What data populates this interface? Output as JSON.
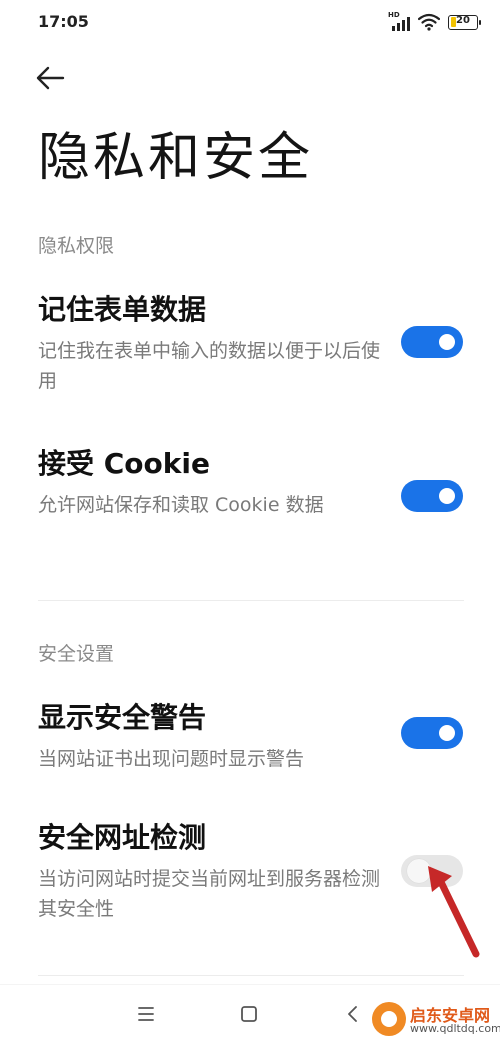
{
  "status_bar": {
    "time": "17:05",
    "network_label": "HD",
    "battery_level": "20",
    "battery_fraction": 0.2,
    "battery_color": "#f2c200"
  },
  "header": {
    "back_icon": "arrow-left-icon",
    "title": "隐私和安全"
  },
  "sections": [
    {
      "header": "隐私权限",
      "items": [
        {
          "title": "记住表单数据",
          "description": "记住我在表单中输入的数据以便于以后使用",
          "enabled": true
        },
        {
          "title": "接受 Cookie",
          "description": "允许网站保存和读取 Cookie 数据",
          "enabled": true
        }
      ]
    },
    {
      "header": "安全设置",
      "items": [
        {
          "title": "显示安全警告",
          "description": "当网站证书出现问题时显示警告",
          "enabled": true
        },
        {
          "title": "安全网址检测",
          "description": "当访问网站时提交当前网址到服务器检测其安全性",
          "enabled": false
        }
      ]
    }
  ],
  "annotation": {
    "arrow_color": "#c62828"
  },
  "nav_bar": {
    "menu_icon": "menu-icon",
    "home_icon": "home-square-icon",
    "back_icon": "back-triangle-icon"
  },
  "watermark": {
    "text": "启东安卓网",
    "url": "www.qdltdq.com"
  },
  "colors": {
    "toggle_on": "#1a73e8",
    "toggle_off": "#e6e6e6",
    "section_header": "#8a8a8a",
    "description": "#7a7a7a"
  }
}
